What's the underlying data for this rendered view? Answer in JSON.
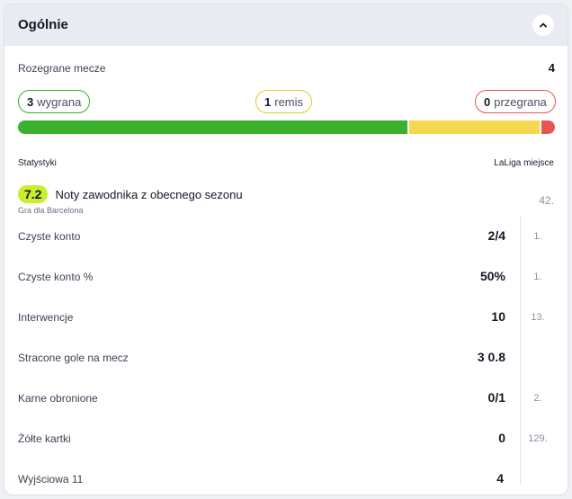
{
  "header": {
    "title": "Ogólnie",
    "toggle_icon": "chevron-up-icon"
  },
  "summary": {
    "matches_label": "Rozegrane mecze",
    "matches_value": "4",
    "wins_count": "3",
    "wins_label": "wygrana",
    "draws_count": "1",
    "draws_label": "remis",
    "losses_count": "0",
    "losses_label": "przegrana",
    "bar": {
      "win_fraction": 0.73,
      "draw_fraction": 0.245,
      "loss_fraction": 0.025
    },
    "colors": {
      "win": "#3ab02c",
      "draw": "#f2d94e",
      "loss": "#ea5353",
      "rating": "#c8ee2c"
    }
  },
  "stats": {
    "section_label": "Statystyki",
    "rank_header": "LaLiga miejsce",
    "rating": {
      "value": "7.2",
      "title": "Noty zawodnika z obecnego sezonu",
      "subtitle": "Gra dla Barcelona",
      "rank": "42."
    },
    "rows": [
      {
        "label": "Czyste konto",
        "value": "2/4",
        "rank": "1."
      },
      {
        "label": "Czyste konto %",
        "value": "50%",
        "rank": "1."
      },
      {
        "label": "Interwencje",
        "value": "10",
        "rank": "13."
      },
      {
        "label": "Stracone gole na mecz",
        "value": "3 0.8",
        "rank": ""
      },
      {
        "label": "Karne obronione",
        "value": "0/1",
        "rank": "2."
      },
      {
        "label": "Żółte kartki",
        "value": "0",
        "rank": "129."
      },
      {
        "label": "Wyjściowa 11",
        "value": "4",
        "rank": ""
      }
    ]
  }
}
